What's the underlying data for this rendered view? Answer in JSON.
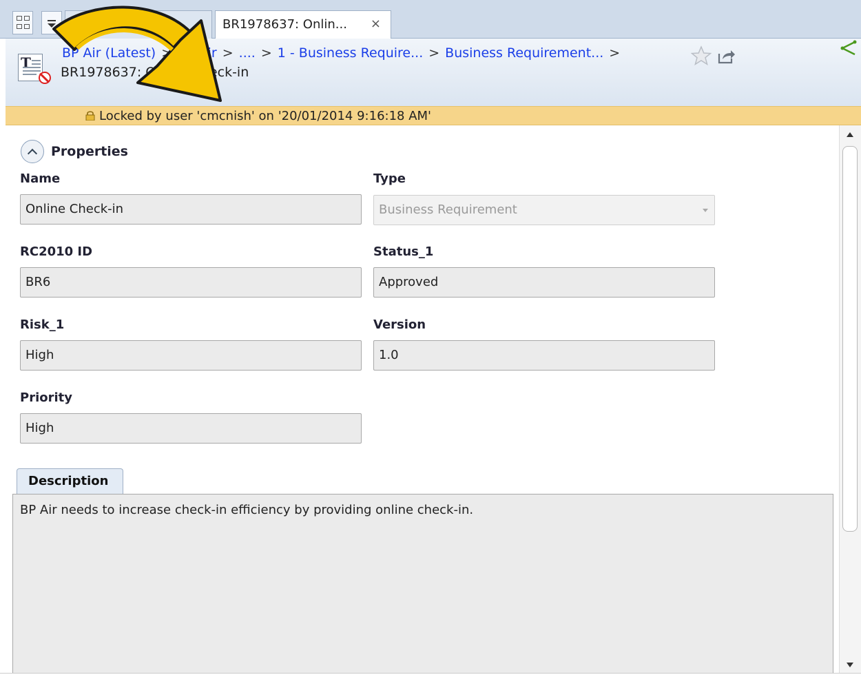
{
  "tabs": {
    "items": [
      {
        "label": "BR1978...: Busi..."
      },
      {
        "label": "BR1978637: Onlin..."
      }
    ],
    "close_glyph": "×"
  },
  "header": {
    "breadcrumb_items": [
      "BP Air (Latest)",
      "BP Air",
      "....",
      "1 - Business Require...",
      "Business Requirement..."
    ],
    "breadcrumb_separator": ">",
    "title": "BR1978637: Online Check-in",
    "icons": [
      "document-icon",
      "locked-badge-icon",
      "star-icon",
      "share-icon",
      "tree-icon"
    ]
  },
  "lock_banner": {
    "text": "Locked by user 'cmcnish' on '20/01/2014 9:16:18 AM'"
  },
  "properties": {
    "section_title": "Properties",
    "name": {
      "label": "Name",
      "value": "Online Check-in"
    },
    "type": {
      "label": "Type",
      "value": "Business Requirement"
    },
    "rc2010_id": {
      "label": "RC2010 ID",
      "value": "BR6"
    },
    "status": {
      "label": "Status_1",
      "value": "Approved"
    },
    "risk": {
      "label": "Risk_1",
      "value": "High"
    },
    "version": {
      "label": "Version",
      "value": "1.0"
    },
    "priority": {
      "label": "Priority",
      "value": "High"
    }
  },
  "description": {
    "tab_label": "Description",
    "text": "BP Air needs to increase check-in efficiency by providing online check-in."
  },
  "colors": {
    "link": "#1a3ee8",
    "lock_banner_bg": "#f6d58a",
    "header_bg": "#dbe5f1",
    "annotation_arrow": "#f5c400"
  }
}
